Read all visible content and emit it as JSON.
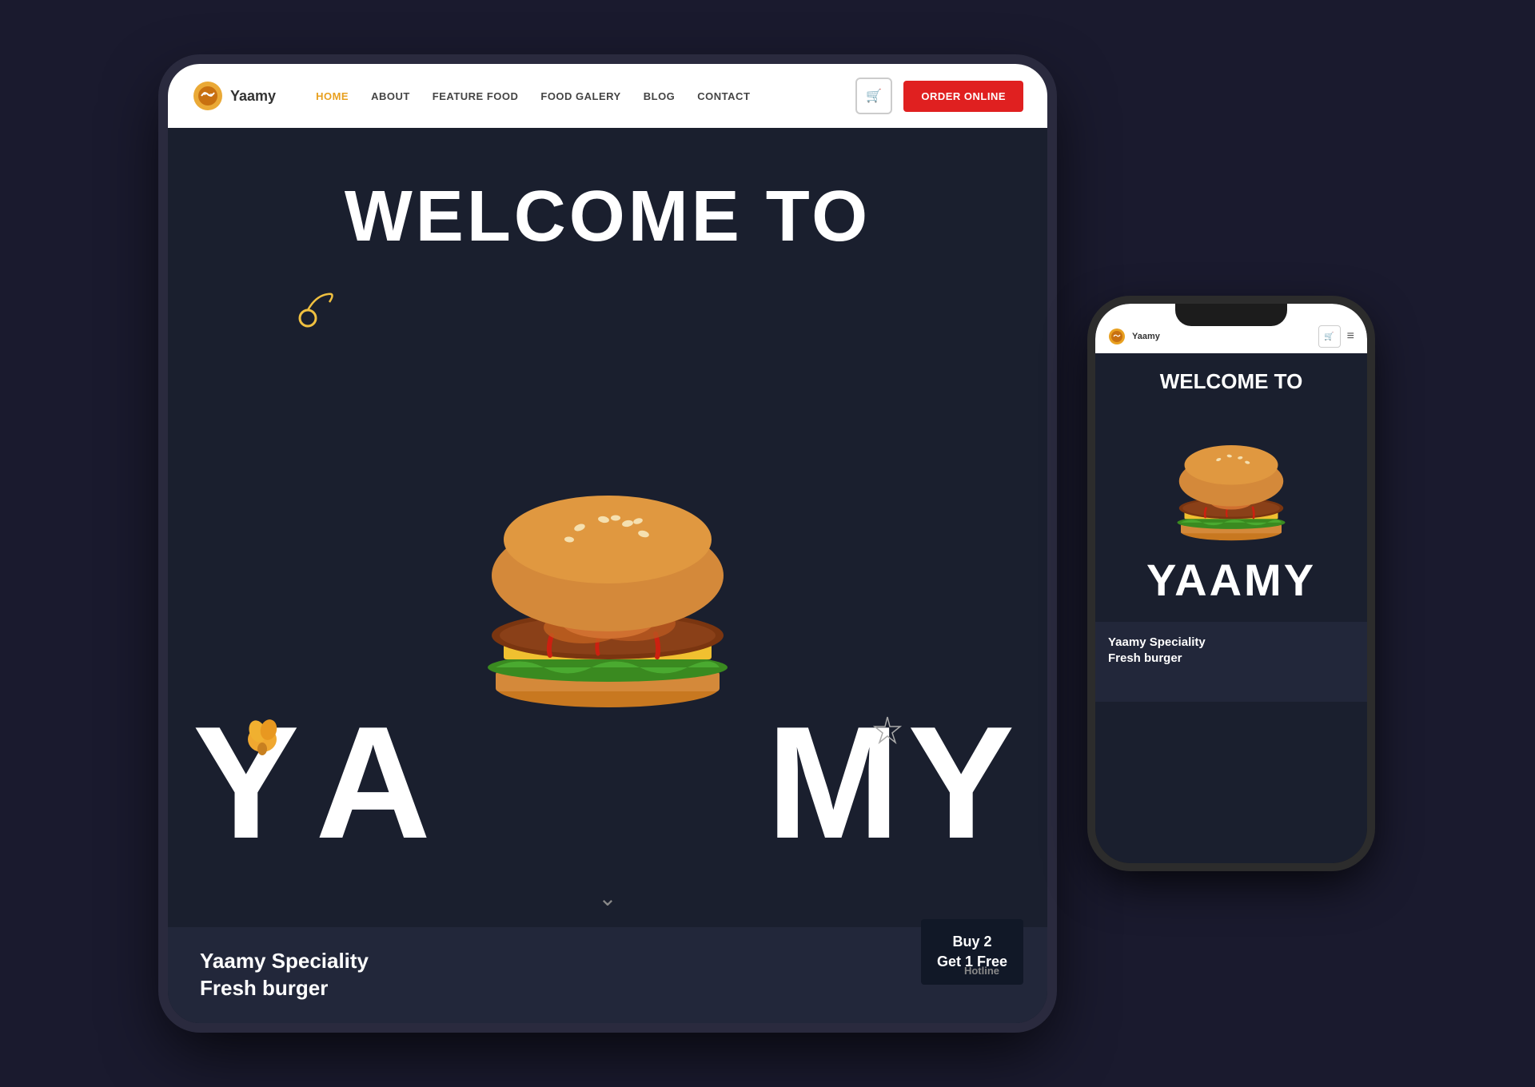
{
  "brand": {
    "name": "Yaamy",
    "logo_emoji": "🍕"
  },
  "navbar": {
    "links": [
      {
        "label": "HOME",
        "active": true
      },
      {
        "label": "ABOUT",
        "active": false
      },
      {
        "label": "FEATURE FOOD",
        "active": false
      },
      {
        "label": "FOOD GALERY",
        "active": false
      },
      {
        "label": "BLOG",
        "active": false
      },
      {
        "label": "CONTACT",
        "active": false
      }
    ],
    "cart_icon": "🛒",
    "order_button": "ORDER ONLINE"
  },
  "hero": {
    "welcome_text": "WELCOME TO",
    "brand_large": "YAAMY",
    "deco_cherry": "🌀",
    "deco_chicken": "🍗",
    "deco_star": "✦",
    "scroll_arrow": "⌄"
  },
  "footer": {
    "tagline_line1": "Yaamy Speciality",
    "tagline_line2": "Fresh burger",
    "promo_line1": "Buy 2",
    "promo_line2": "Get 1 Free",
    "hotline_label": "Hotline"
  },
  "colors": {
    "accent_gold": "#e8a020",
    "accent_red": "#e02020",
    "bg_dark": "#1a1f2e",
    "bg_footer": "#22273a",
    "white": "#ffffff"
  }
}
